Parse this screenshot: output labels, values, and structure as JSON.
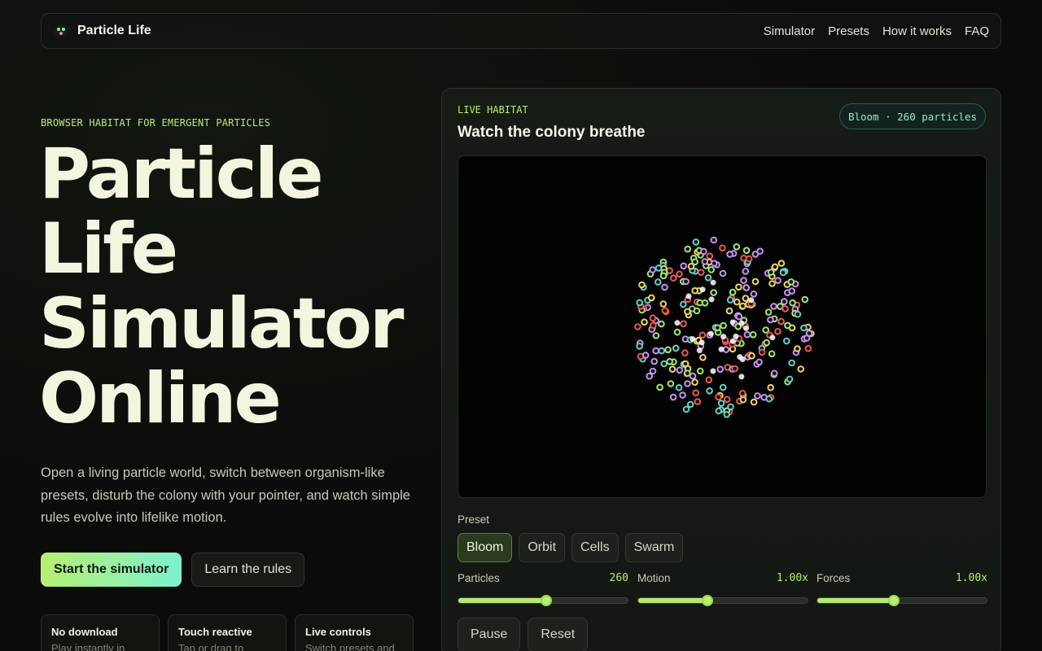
{
  "nav": {
    "brand": "Particle Life",
    "links": [
      "Simulator",
      "Presets",
      "How it works",
      "FAQ"
    ]
  },
  "hero": {
    "eyebrow": "BROWSER HABITAT FOR EMERGENT PARTICLES",
    "title_lines": [
      "Particle",
      "Life",
      "Simulator",
      "Online"
    ],
    "description": "Open a living particle world, switch between organism-like presets, disturb the colony with your pointer, and watch simple rules evolve into lifelike motion.",
    "primary_cta": "Start the simulator",
    "secondary_cta": "Learn the rules"
  },
  "features": [
    {
      "title": "No download",
      "text": "Play instantly in"
    },
    {
      "title": "Touch reactive",
      "text": "Tap or drag to"
    },
    {
      "title": "Live controls",
      "text": "Switch presets and"
    }
  ],
  "panel": {
    "eyebrow": "LIVE HABITAT",
    "title": "Watch the colony breathe",
    "badge": "Bloom · 260 particles",
    "preset_label": "Preset",
    "presets": [
      "Bloom",
      "Orbit",
      "Cells",
      "Swarm"
    ],
    "active_preset": "Bloom",
    "sliders": [
      {
        "label": "Particles",
        "value_text": "260",
        "fraction": 0.52
      },
      {
        "label": "Motion",
        "value_text": "1.00x",
        "fraction": 0.41
      },
      {
        "label": "Forces",
        "value_text": "1.00x",
        "fraction": 0.45
      }
    ],
    "actions": [
      "Pause",
      "Reset"
    ]
  },
  "colors": {
    "accent_lime": "#b9ef6c",
    "accent_teal": "#7ef0d0",
    "particle_palette": [
      "#9fe870",
      "#f0d560",
      "#e85a4a",
      "#c890f0",
      "#60d0c8",
      "#ffffff"
    ]
  },
  "icons": {
    "logo": "particle-logo-icon"
  }
}
